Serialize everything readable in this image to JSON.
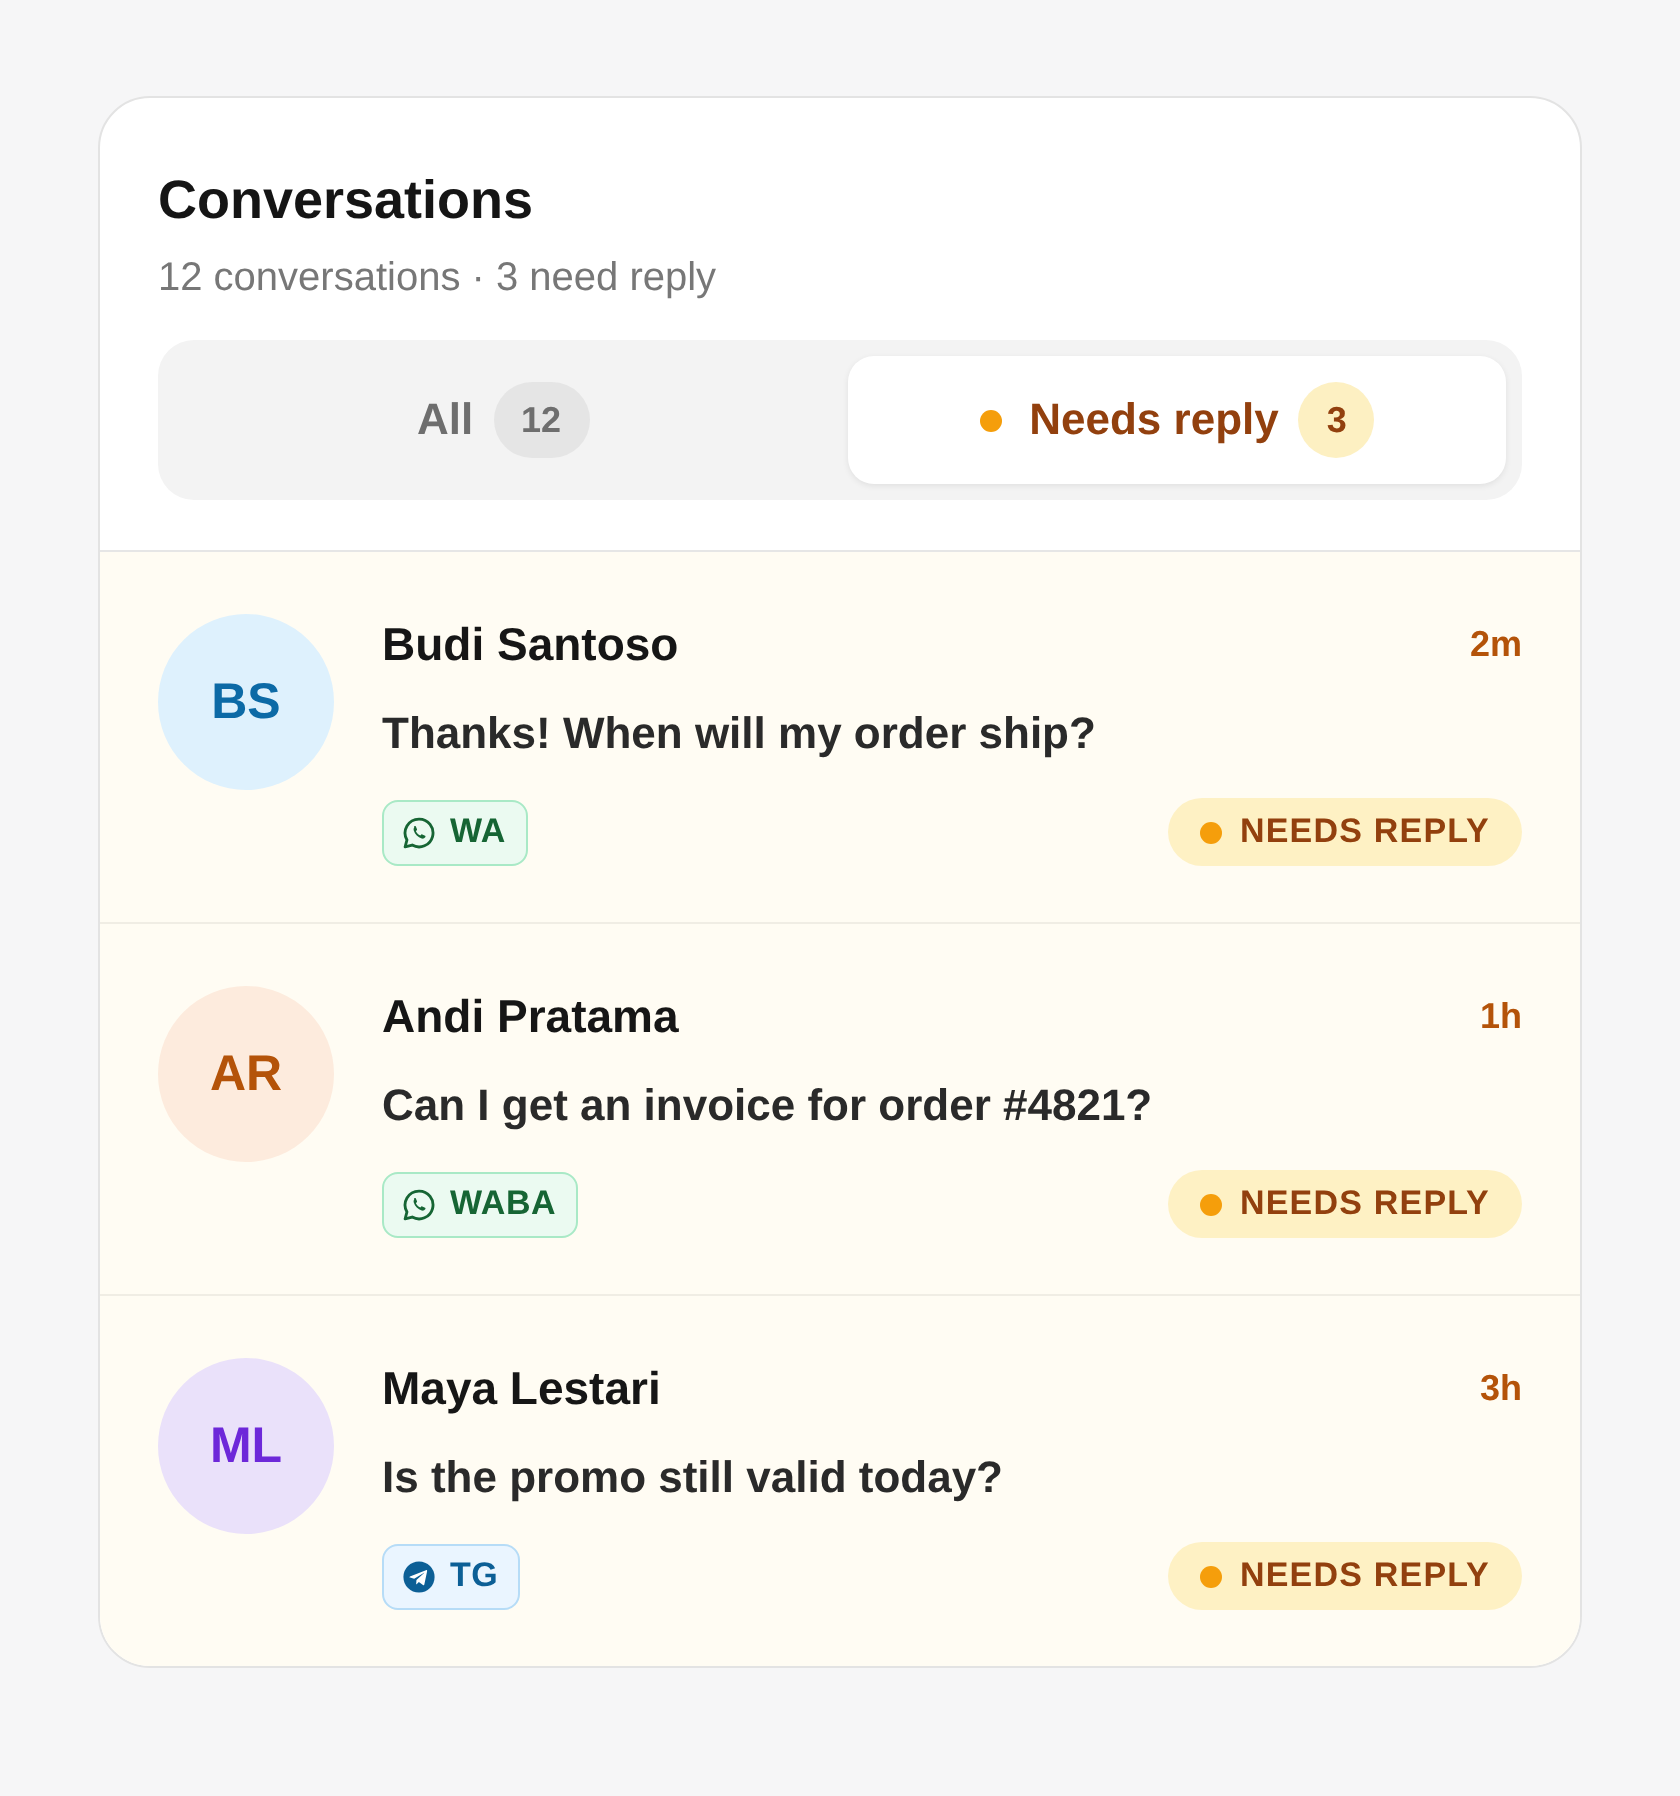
{
  "header": {
    "title": "Conversations",
    "subtitle": "12 conversations · 3 need reply"
  },
  "tabs": [
    {
      "label": "All",
      "count": "12",
      "selected": false,
      "dot": false
    },
    {
      "label": "Needs reply",
      "count": "3",
      "selected": true,
      "dot": true
    }
  ],
  "conversations": [
    {
      "avatar": {
        "initials": "BS",
        "color": "#0c6aa6"
      },
      "name": "Budi Santoso",
      "time": "2m",
      "message": "Thanks! When will my order ship?",
      "channel": {
        "kind": "whatsapp",
        "label": "WA"
      },
      "needs_reply": true,
      "status": "NEEDS REPLY"
    },
    {
      "avatar": {
        "initials": "AR",
        "color": "#b45309"
      },
      "name": "Andi Pratama",
      "time": "1h",
      "message": "Can I get an invoice for order #4821?",
      "channel": {
        "kind": "whatsapp",
        "label": "WABA"
      },
      "needs_reply": true,
      "status": "NEEDS REPLY"
    },
    {
      "avatar": {
        "initials": "ML",
        "color": "#6d28d9"
      },
      "name": "Maya Lestari",
      "time": "3h",
      "message": "Is the promo still valid today?",
      "channel": {
        "kind": "telegram",
        "label": "TG"
      },
      "needs_reply": true,
      "status": "NEEDS REPLY"
    }
  ]
}
